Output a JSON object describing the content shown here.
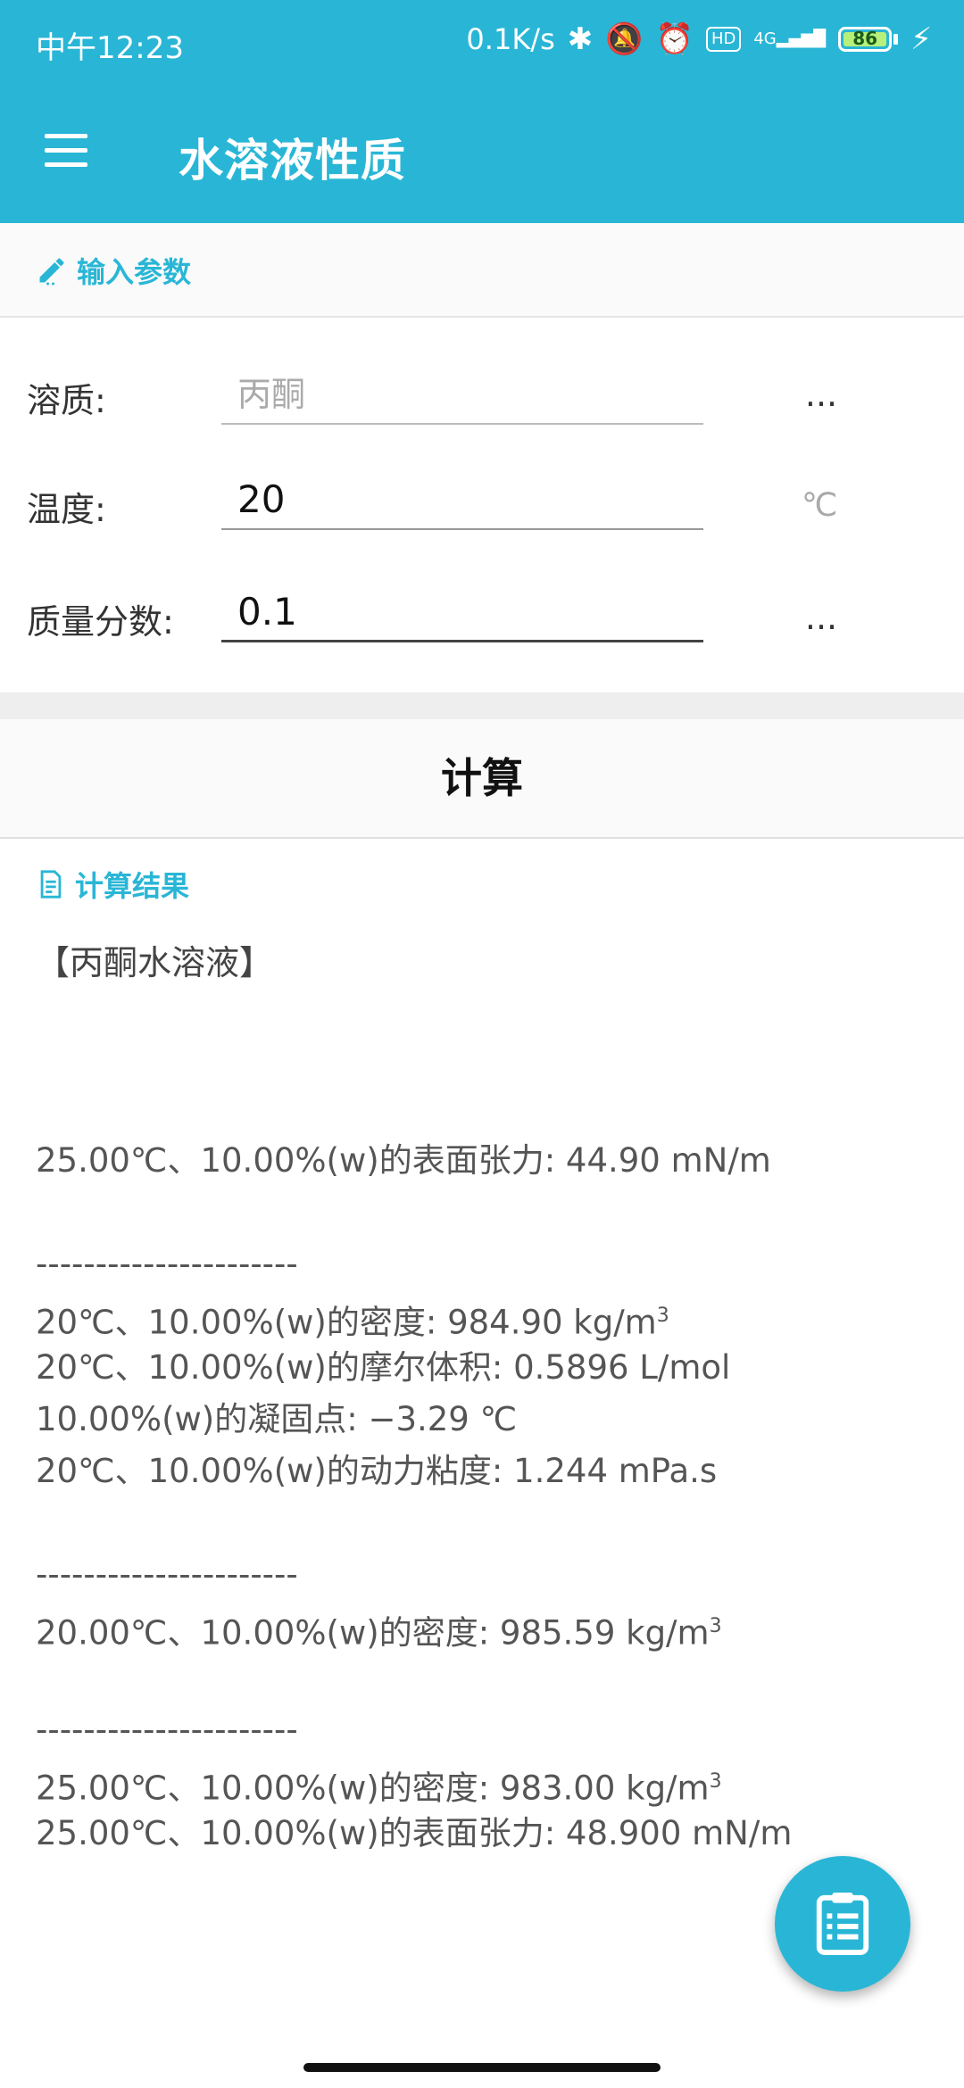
{
  "status_bar": {
    "time": "中午12:23",
    "net_speed": "0.1K/s",
    "hd": "HD",
    "signal_label": "4G",
    "battery": "86"
  },
  "app_bar": {
    "title": "水溶液性质",
    "menu_icon": "hamburger-menu-icon"
  },
  "input_section": {
    "header": "输入参数",
    "solute_label": "溶质:",
    "solute_placeholder": "丙酮",
    "solute_more": "...",
    "temperature_label": "温度:",
    "temperature_value": "20",
    "temperature_unit": "℃",
    "mass_fraction_label": "质量分数:",
    "mass_fraction_value": "0.1",
    "mass_fraction_more": "..."
  },
  "calculate_button": "计算",
  "result_section": {
    "header": "计算结果",
    "title": "【丙酮水溶液】",
    "lines": [
      "25.00℃、10.00%(w)的表面张力: 44.90 mN/m",
      "",
      "----------------------",
      "20℃、10.00%(w)的密度: 984.90 kg/m",
      "20℃、10.00%(w)的摩尔体积: 0.5896 L/mol",
      "10.00%(w)的凝固点: −3.29 ℃",
      "20℃、10.00%(w)的动力粘度: 1.244 mPa.s",
      "",
      "----------------------",
      "20.00℃、10.00%(w)的密度: 985.59 kg/m",
      "",
      "----------------------",
      "25.00℃、10.00%(w)的密度: 983.00 kg/m",
      "25.00℃、10.00%(w)的表面张力: 48.900 mN/m"
    ],
    "superscript": "3"
  },
  "colors": {
    "primary": "#29b6d6",
    "background": "#ffffff"
  }
}
